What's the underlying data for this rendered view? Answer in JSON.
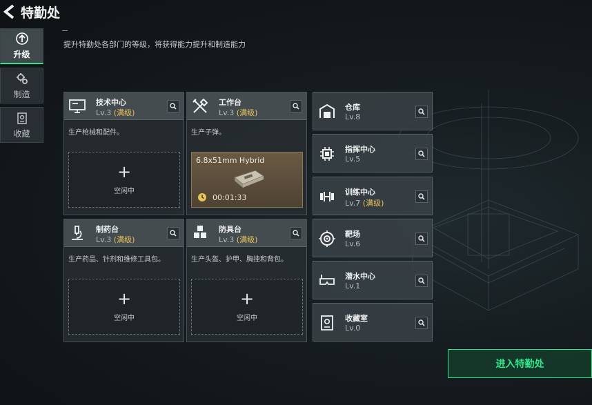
{
  "header": {
    "title": "特勤处"
  },
  "nav": [
    {
      "label": "升级",
      "active": true,
      "icon": "upgrade-icon"
    },
    {
      "label": "制造",
      "active": false,
      "icon": "gears-icon"
    },
    {
      "label": "收藏",
      "active": false,
      "icon": "collection-icon"
    }
  ],
  "subtitle": "提升特勤处各部门的等级，将获得能力提升和制造能力",
  "cards": [
    {
      "name": "技术中心",
      "level": "Lv.3",
      "maxed": "(满级)",
      "desc": "生产枪械和配件。",
      "slot": "空闲中",
      "icon": "monitor-icon"
    },
    {
      "name": "工作台",
      "level": "Lv.3",
      "maxed": "(满级)",
      "desc": "生产子弹。",
      "icon": "tools-icon",
      "crafting": {
        "item": "6.8x51mm Hybrid",
        "time": "00:01:33",
        "icon": "ammo-box-icon"
      }
    },
    {
      "name": "制药台",
      "level": "Lv.3",
      "maxed": "(满级)",
      "desc": "生产药品、针剂和维修工具包。",
      "slot": "空闲中",
      "icon": "microscope-icon"
    },
    {
      "name": "防具台",
      "level": "Lv.3",
      "maxed": "(满级)",
      "desc": "生产头盔、护甲、胸挂和背包。",
      "slot": "空闲中",
      "icon": "cubes-icon"
    }
  ],
  "rooms": [
    {
      "name": "仓库",
      "level": "Lv.8",
      "maxed": "",
      "icon": "warehouse-icon"
    },
    {
      "name": "指挥中心",
      "level": "Lv.5",
      "maxed": "",
      "icon": "chip-icon"
    },
    {
      "name": "训练中心",
      "level": "Lv.7",
      "maxed": "(满级)",
      "icon": "dumbbell-icon"
    },
    {
      "name": "靶场",
      "level": "Lv.6",
      "maxed": "",
      "icon": "target-icon"
    },
    {
      "name": "潜水中心",
      "level": "Lv.1",
      "maxed": "",
      "icon": "diving-mask-icon"
    },
    {
      "name": "收藏室",
      "level": "Lv.0",
      "maxed": "",
      "icon": "trophy-case-icon"
    }
  ],
  "enter_button": "进入特勤处",
  "colors": {
    "accent": "#2ee58b",
    "maxed": "#e9c35c"
  }
}
